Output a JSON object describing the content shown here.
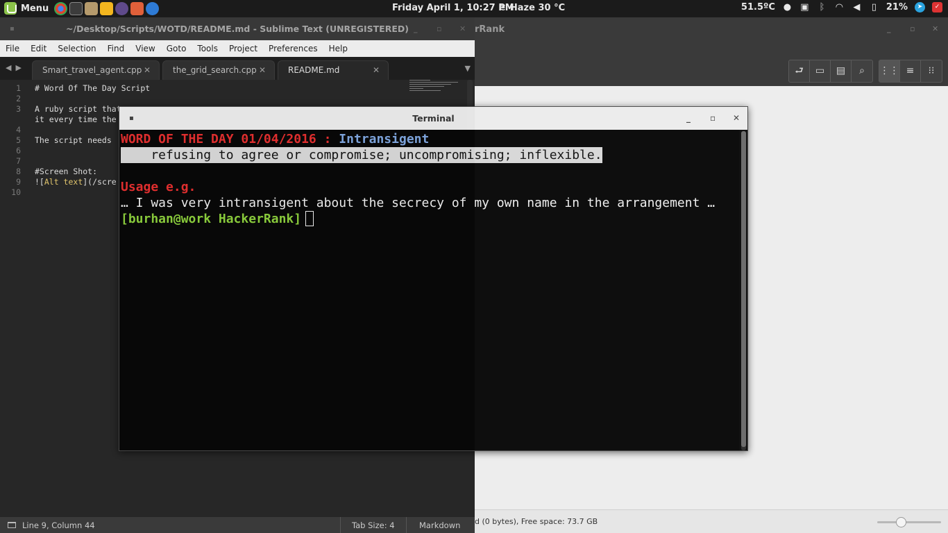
{
  "panel": {
    "menu_label": "Menu",
    "launchers": [
      {
        "name": "chrome",
        "color": "#e0452c"
      },
      {
        "name": "terminal",
        "color": "#3c3c3c"
      },
      {
        "name": "files",
        "color": "#b59a6c"
      },
      {
        "name": "keep",
        "color": "#f3b61f"
      },
      {
        "name": "eclipse",
        "color": "#5f4a8b"
      },
      {
        "name": "app-m",
        "color": "#e0603a"
      },
      {
        "name": "app-b",
        "color": "#2e7bd6"
      }
    ],
    "clock": "Friday April  1, 10:27 PM",
    "weather": "Haze 30 °C",
    "temperature": "51.5ºC",
    "battery": "21%"
  },
  "file_manager": {
    "title": "rRank",
    "status": "d (0 bytes), Free space: 73.7 GB",
    "zoom_level": 0.35
  },
  "sublime": {
    "title": "~/Desktop/Scripts/WOTD/README.md - Sublime Text (UNREGISTERED)",
    "menu": [
      "File",
      "Edit",
      "Selection",
      "Find",
      "View",
      "Goto",
      "Tools",
      "Project",
      "Preferences",
      "Help"
    ],
    "tabs": [
      {
        "label": "Smart_travel_agent.cpp",
        "active": false
      },
      {
        "label": "the_grid_search.cpp",
        "active": false
      },
      {
        "label": "README.md",
        "active": true
      }
    ],
    "lines": [
      {
        "num": "1",
        "text": "# Word Of The Day Script"
      },
      {
        "num": "2",
        "text": ""
      },
      {
        "num": "3",
        "text": "A ruby script that"
      },
      {
        "num": "",
        "text": "it every time the"
      },
      {
        "num": "4",
        "text": ""
      },
      {
        "num": "5",
        "text": "The script needs"
      },
      {
        "num": "6",
        "text": ""
      },
      {
        "num": "7",
        "text": ""
      },
      {
        "num": "8",
        "text": "#Screen Shot:"
      },
      {
        "num": "9",
        "text_a": "![",
        "text_b": "Alt text",
        "text_c": "](/scre"
      },
      {
        "num": "10",
        "text": ""
      }
    ],
    "status": {
      "position": "Line 9, Column 44",
      "tab_size": "Tab Size: 4",
      "syntax": "Markdown"
    }
  },
  "terminal": {
    "title": "Terminal",
    "wotd_prefix": "WORD OF THE DAY 01/04/2016 : ",
    "word": "Intransigent",
    "definition": "    refusing to agree or compromise; uncompromising; inflexible.",
    "usage_label": "Usage e.g.",
    "usage_text": "… I was very intransigent about the secrecy of my own name in the arrangement …",
    "prompt": "[burhan@work HackerRank]"
  }
}
